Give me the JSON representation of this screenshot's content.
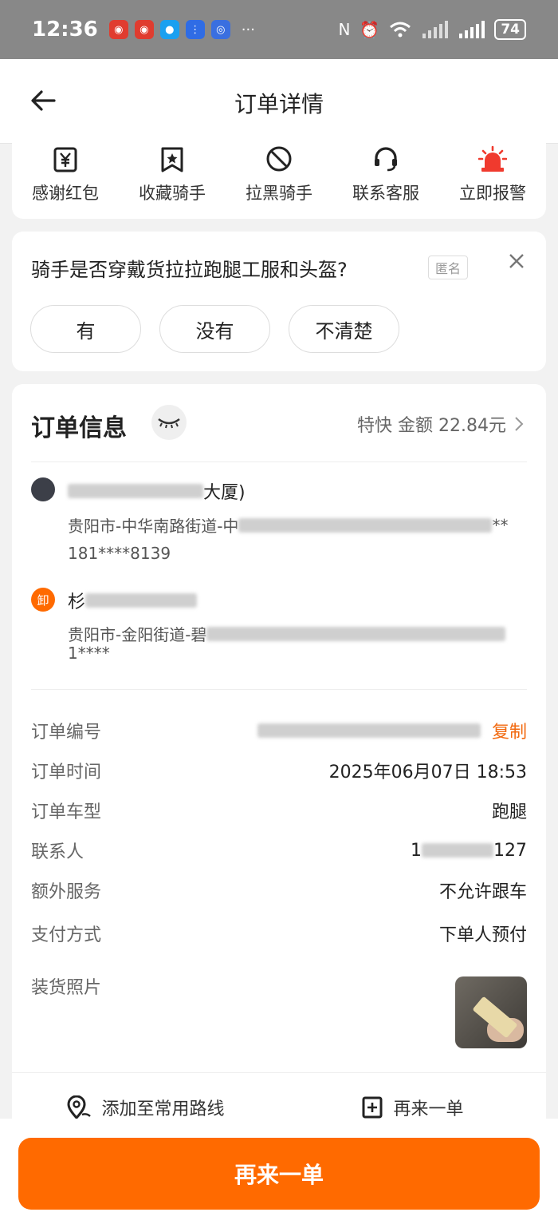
{
  "status_bar": {
    "time": "12:36",
    "more": "···",
    "battery": "74"
  },
  "nav": {
    "title": "订单详情"
  },
  "actions": [
    {
      "label": "感谢红包",
      "icon": "yuan-icon"
    },
    {
      "label": "收藏骑手",
      "icon": "bookmark-star-icon"
    },
    {
      "label": "拉黑骑手",
      "icon": "block-icon"
    },
    {
      "label": "联系客服",
      "icon": "headset-icon"
    },
    {
      "label": "立即报警",
      "icon": "alarm-icon"
    }
  ],
  "survey": {
    "question": "骑手是否穿戴货拉拉跑腿工服和头盔?",
    "badge": "匿名",
    "options": [
      "有",
      "没有",
      "不清楚"
    ]
  },
  "order_info": {
    "title": "订单信息",
    "summary": "特快 金额 22.84元",
    "pickup": {
      "name_suffix": "大厦)",
      "address_prefix": "贵阳市-中华南路街道-中",
      "address_suffix": "**",
      "phone": "181****8139"
    },
    "dropoff": {
      "badge": "卸",
      "name_prefix": "杉",
      "address_prefix": "贵阳市-金阳街道-碧",
      "address_line2": "1****"
    },
    "rows": [
      {
        "label": "订单编号",
        "value": "",
        "action": "复制"
      },
      {
        "label": "订单时间",
        "value": "2025年06月07日 18:53"
      },
      {
        "label": "订单车型",
        "value": "跑腿"
      },
      {
        "label": "联系人",
        "value_prefix": "1",
        "value_suffix": "127"
      },
      {
        "label": "额外服务",
        "value": "不允许跟车"
      },
      {
        "label": "支付方式",
        "value": "下单人预付"
      },
      {
        "label": "装货照片"
      }
    ]
  },
  "links": {
    "add_route": "添加至常用路线",
    "reorder": "再来一单"
  },
  "bottom_button": "再来一单",
  "colors": {
    "accent": "#ff6a00",
    "link": "#f26a10",
    "alarm": "#f03a2e"
  }
}
